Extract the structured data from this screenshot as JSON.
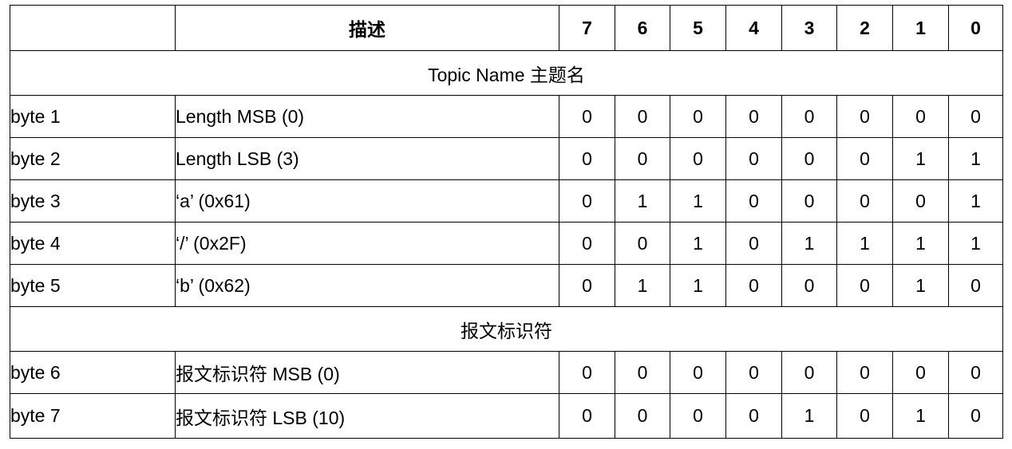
{
  "table": {
    "header": {
      "blank": "",
      "description": "描述",
      "bits": [
        "7",
        "6",
        "5",
        "4",
        "3",
        "2",
        "1",
        "0"
      ]
    },
    "sections": [
      {
        "title": "Topic Name 主题名",
        "rows": [
          {
            "byte": "byte 1",
            "desc": "Length MSB (0)",
            "bits": [
              "0",
              "0",
              "0",
              "0",
              "0",
              "0",
              "0",
              "0"
            ]
          },
          {
            "byte": "byte 2",
            "desc": "Length LSB (3)",
            "bits": [
              "0",
              "0",
              "0",
              "0",
              "0",
              "0",
              "1",
              "1"
            ]
          },
          {
            "byte": "byte 3",
            "desc": "‘a’ (0x61)",
            "bits": [
              "0",
              "1",
              "1",
              "0",
              "0",
              "0",
              "0",
              "1"
            ]
          },
          {
            "byte": "byte 4",
            "desc": "‘/’ (0x2F)",
            "bits": [
              "0",
              "0",
              "1",
              "0",
              "1",
              "1",
              "1",
              "1"
            ]
          },
          {
            "byte": "byte 5",
            "desc": "‘b’ (0x62)",
            "bits": [
              "0",
              "1",
              "1",
              "0",
              "0",
              "0",
              "1",
              "0"
            ]
          }
        ]
      },
      {
        "title": "报文标识符",
        "rows": [
          {
            "byte": "byte 6",
            "desc": "报文标识符 MSB (0)",
            "bits": [
              "0",
              "0",
              "0",
              "0",
              "0",
              "0",
              "0",
              "0"
            ]
          },
          {
            "byte": "byte 7",
            "desc": "报文标识符 LSB (10)",
            "bits": [
              "0",
              "0",
              "0",
              "0",
              "1",
              "0",
              "1",
              "0"
            ]
          }
        ]
      }
    ]
  }
}
